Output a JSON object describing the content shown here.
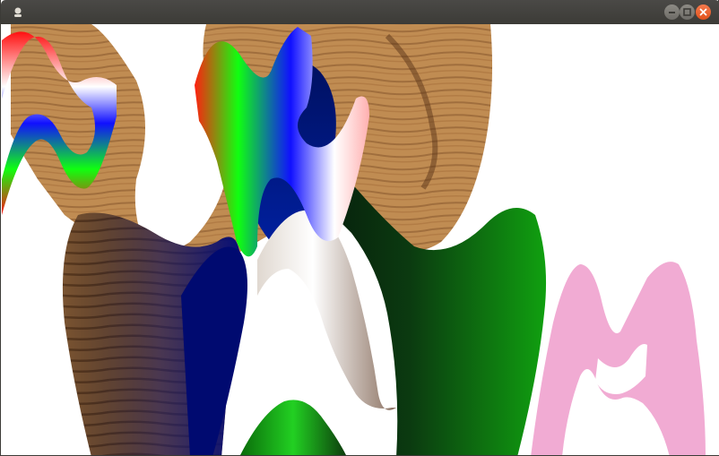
{
  "window": {
    "title": "",
    "controls": {
      "minimize": "minimize",
      "maximize": "maximize",
      "close": "close"
    }
  },
  "icons": {
    "app": "app-icon",
    "minimize": "minimize-icon",
    "maximize": "maximize-icon",
    "close": "close-icon"
  },
  "colors": {
    "titlebar": "#3c3b37",
    "close_button": "#e95420",
    "wood_light": "#c08c50",
    "wood_dark": "#6b4225",
    "pink_shape": "#f1abd3",
    "green_shape": "#0d6b0d",
    "navy_shape": "#0a1660"
  }
}
